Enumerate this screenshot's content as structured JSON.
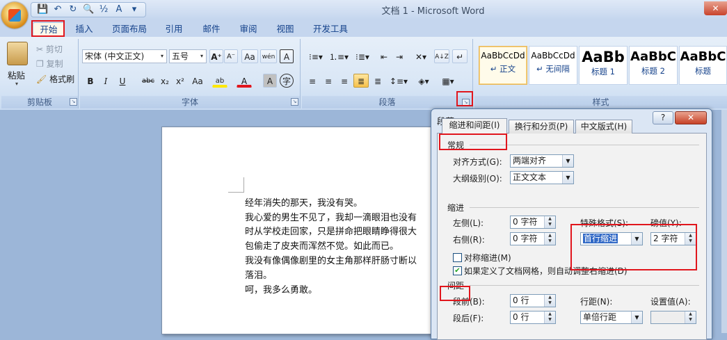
{
  "window": {
    "title": "文档 1 - Microsoft Word",
    "close_glyph": "✕"
  },
  "qat": {
    "icons": [
      "save-icon",
      "undo-icon",
      "redo-icon",
      "print-preview-icon",
      "fraction-icon",
      "font-color-icon",
      "customize-icon"
    ],
    "glyphs": [
      "💾",
      "↶",
      "↻",
      "🔍",
      "½",
      "A",
      "▾"
    ]
  },
  "tabs": [
    "开始",
    "插入",
    "页面布局",
    "引用",
    "邮件",
    "审阅",
    "视图",
    "开发工具"
  ],
  "clipboard": {
    "paste": "粘贴",
    "cut": "剪切",
    "copy": "复制",
    "format_painter": "格式刷",
    "label": "剪贴板"
  },
  "font": {
    "name": "宋体 (中文正文)",
    "size": "五号",
    "label": "字体",
    "buttons_row1": [
      "A⁺",
      "A⁻",
      "Aa",
      "wén",
      "A"
    ],
    "buttons_row2": [
      "B",
      "I",
      "U",
      "abc",
      "x₂",
      "x²",
      "Aa",
      "ab",
      "A",
      "A",
      "字"
    ]
  },
  "paragraph": {
    "label": "段落"
  },
  "styles": {
    "label": "样式",
    "items": [
      {
        "sample": "AaBbCcDd",
        "name": "↵ 正文"
      },
      {
        "sample": "AaBbCcDd",
        "name": "↵ 无间隔"
      },
      {
        "sample": "AaBb",
        "name": "标题 1"
      },
      {
        "sample": "AaBbC",
        "name": "标题 2"
      },
      {
        "sample": "AaBbC",
        "name": "标题"
      }
    ]
  },
  "document": {
    "paragraphs": [
      "经年消失的那天，我没有哭。",
      "我心爱的男生不见了，我却一滴眼泪也没有",
      "时从学校走回家，只是拼命把眼睛睁得很大",
      "包偷走了皮夹而浑然不觉。如此而已。",
      "我没有像偶像剧里的女主角那样肝肠寸断以",
      "落泪。",
      "呵，我多么勇敢。"
    ]
  },
  "dialog": {
    "title": "段落",
    "help": "?",
    "close": "✕",
    "tabs": [
      "缩进和间距(I)",
      "换行和分页(P)",
      "中文版式(H)"
    ],
    "general": {
      "heading": "常规",
      "alignment_label": "对齐方式(G):",
      "alignment_value": "两端对齐",
      "outline_label": "大纲级别(O):",
      "outline_value": "正文文本"
    },
    "indent": {
      "heading": "缩进",
      "left_label": "左侧(L):",
      "left_value": "0 字符",
      "right_label": "右侧(R):",
      "right_value": "0 字符",
      "special_label": "特殊格式(S):",
      "special_value": "首行缩进",
      "by_label": "磅值(Y):",
      "by_value": "2 字符",
      "mirror_label": "对称缩进(M)",
      "mirror_checked": false,
      "grid_label": "如果定义了文档网格，则自动调整右缩进(D)",
      "grid_checked": true
    },
    "spacing": {
      "heading": "间距",
      "before_label": "段前(B):",
      "before_value": "0 行",
      "after_label": "段后(F):",
      "after_value": "0 行",
      "line_label": "行距(N):",
      "line_value": "单倍行距",
      "at_label": "设置值(A):",
      "at_value": ""
    }
  },
  "colors": {
    "highlight": "#e1161d",
    "accent": "#15428b"
  }
}
